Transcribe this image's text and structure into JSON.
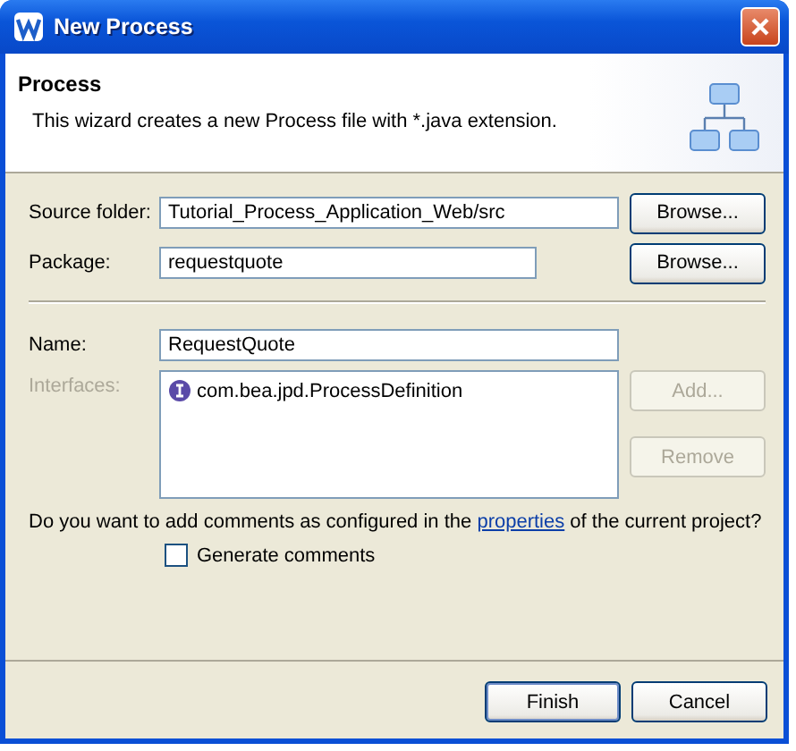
{
  "window": {
    "title": "New Process"
  },
  "header": {
    "title": "Process",
    "description": "This wizard creates a new Process file with *.java extension."
  },
  "source_folder": {
    "label": "Source folder:",
    "value": "Tutorial_Process_Application_Web/src",
    "button": {
      "label": "Browse...",
      "disabled": false
    }
  },
  "package": {
    "label": "Package:",
    "value": "requestquote",
    "button": {
      "label": "Browse...",
      "disabled": false
    }
  },
  "name": {
    "label": "Name:",
    "value": "RequestQuote"
  },
  "interfaces": {
    "label": "Interfaces:",
    "disabled": true,
    "items": [
      {
        "label": "com.bea.jpd.ProcessDefinition",
        "selected": false
      }
    ],
    "buttons": [
      {
        "label": "Add...",
        "disabled": true
      },
      {
        "label": "Remove",
        "disabled": true
      }
    ]
  },
  "comment_prompt": {
    "before": "Do you want to add comments as configured in the ",
    "link": "properties",
    "after": " of the current project?"
  },
  "generate_comments": {
    "label": "Generate comments",
    "checked": false
  },
  "buttons": [
    {
      "label": "Finish",
      "default": true,
      "disabled": false
    },
    {
      "label": "Cancel",
      "default": false,
      "disabled": false
    }
  ]
}
